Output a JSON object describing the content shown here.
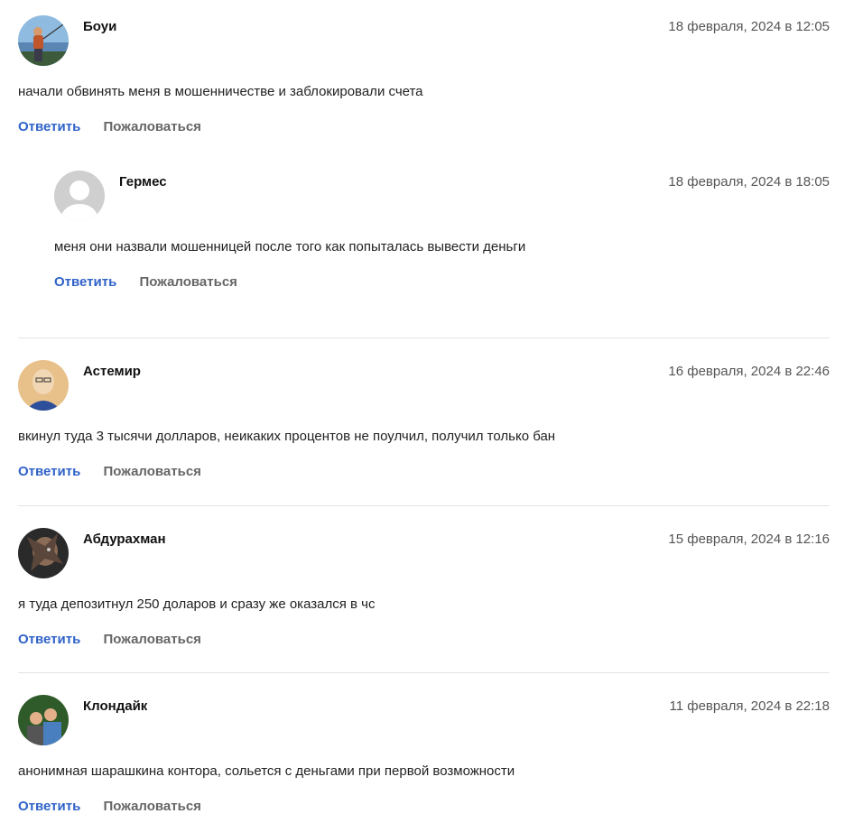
{
  "actions": {
    "reply_label": "Ответить",
    "report_label": "Пожаловаться"
  },
  "comments": [
    {
      "author": "Боуи",
      "date": "18 февраля, 2024 в 12:05",
      "text": "начали обвинять меня в мошенничестве и заблокировали счета",
      "avatar_colors": [
        "#7aa9d8",
        "#b7d3ee",
        "#c0562b",
        "#3d5a3a"
      ]
    },
    {
      "author": "Гермес",
      "date": "18 февраля, 2024 в 18:05",
      "text": "меня они назвали мошенницей после того как попыталась вывести деньги",
      "avatar_colors": [
        "#cfcfcf",
        "#ffffff"
      ]
    },
    {
      "author": "Астемир",
      "date": "16 февраля, 2024 в 22:46",
      "text": "вкинул туда 3 тысячи долларов, неикаких процентов не поулчил, получил только бан",
      "avatar_colors": [
        "#e7c08a",
        "#f1d7b3",
        "#2d4e9a"
      ]
    },
    {
      "author": "Абдурахман",
      "date": "15 февраля, 2024 в 12:16",
      "text": "я туда депозитнул 250 доларов и сразу же оказался в чс",
      "avatar_colors": [
        "#2a2a2a",
        "#8a6b55",
        "#c9c9c9"
      ]
    },
    {
      "author": "Клондайк",
      "date": "11 февраля, 2024 в 22:18",
      "text": "анонимная шарашкина контора, сольется с деньгами при первой возможности",
      "avatar_colors": [
        "#2f5b2a",
        "#4a7fbf",
        "#e4b08a"
      ]
    }
  ]
}
